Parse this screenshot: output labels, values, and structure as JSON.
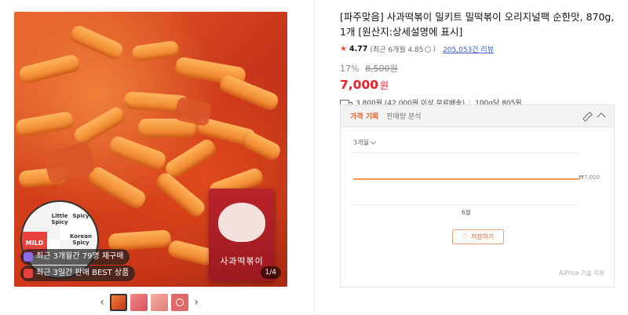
{
  "gallery": {
    "badges": [
      "최근 3개월간 79명 재구매",
      "최근 3일간 판매 BEST 상품"
    ],
    "counter": "1/4",
    "pack_label": "사과떡볶이",
    "spice_levels": [
      "Little Spicy",
      "Spicy",
      "Korean Spicy",
      "MILD"
    ]
  },
  "product": {
    "title": "[파주맞음] 사과떡볶이 밀키트 밀떡볶이 오리지널팩 순한맛, 870g, 1개 [원산지:상세설명에 표시]",
    "rating": "4.77",
    "rating_detail": "(최근 6개월 4.85",
    "reviews": "205,053건 리뷰",
    "discount": "17%",
    "original_price": "8,500원",
    "price": "7,000",
    "currency": "원",
    "shipping": "3,800원 (42,000원 이상 무료배송)",
    "unit_price": "100g당 805원"
  },
  "price_history": {
    "tab_active": "가격 기록",
    "tab_other": "판매량 분석",
    "period": "3개월",
    "current_price_label": "₩7,000",
    "month_label": "6월",
    "save_label": "저장하기",
    "powered": "AiPrice 기술 지원",
    "accent_color": "#e8602c"
  }
}
